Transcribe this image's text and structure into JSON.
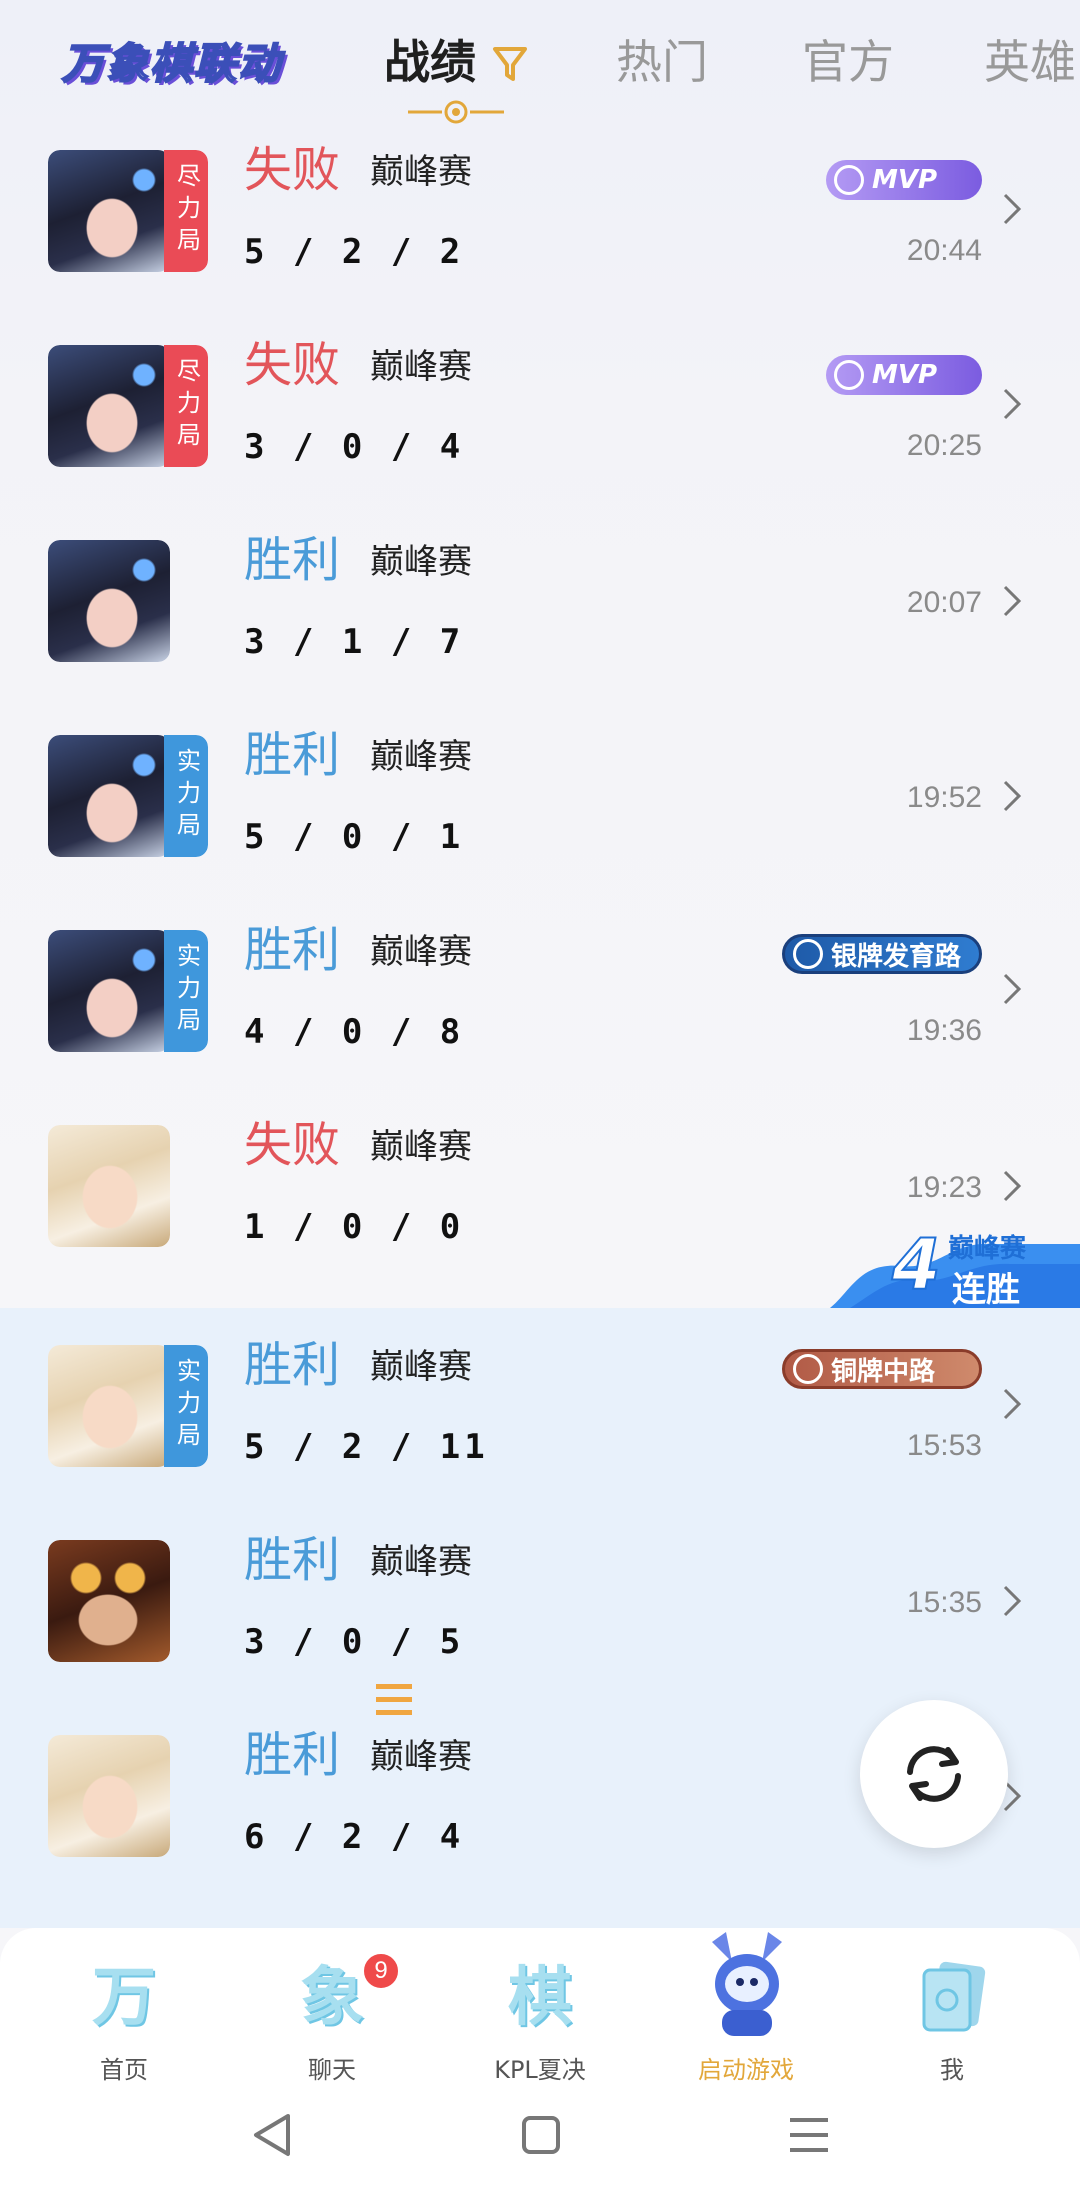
{
  "header": {
    "logo": "万象棋联动",
    "tabs": [
      {
        "label": "战绩",
        "active": true
      },
      {
        "label": "热门",
        "active": false
      },
      {
        "label": "官方",
        "active": false
      },
      {
        "label": "英雄",
        "active": false
      }
    ]
  },
  "matches": [
    {
      "result": "失败",
      "mode": "巅峰赛",
      "kda": "5 / 2 / 2",
      "time": "20:44",
      "tag": "尽力局",
      "badge": "MVP"
    },
    {
      "result": "失败",
      "mode": "巅峰赛",
      "kda": "3 / 0 / 4",
      "time": "20:25",
      "tag": "尽力局",
      "badge": "MVP"
    },
    {
      "result": "胜利",
      "mode": "巅峰赛",
      "kda": "3 / 1 / 7",
      "time": "20:07",
      "tag": "",
      "badge": ""
    },
    {
      "result": "胜利",
      "mode": "巅峰赛",
      "kda": "5 / 0 / 1",
      "time": "19:52",
      "tag": "实力局",
      "badge": ""
    },
    {
      "result": "胜利",
      "mode": "巅峰赛",
      "kda": "4 / 0 / 8",
      "time": "19:36",
      "tag": "实力局",
      "badge": "银牌发育路"
    },
    {
      "result": "失败",
      "mode": "巅峰赛",
      "kda": "1 / 0 / 0",
      "time": "19:23",
      "tag": "",
      "badge": ""
    },
    {
      "result": "胜利",
      "mode": "巅峰赛",
      "kda": "5 / 2 / 11",
      "time": "15:53",
      "tag": "实力局",
      "badge": "铜牌中路"
    },
    {
      "result": "胜利",
      "mode": "巅峰赛",
      "kda": "3 / 0 / 5",
      "time": "15:35",
      "tag": "",
      "badge": ""
    },
    {
      "result": "胜利",
      "mode": "巅峰赛",
      "kda": "6 / 2 / 4",
      "time": "",
      "tag": "",
      "badge": ""
    }
  ],
  "streak": {
    "count": "4",
    "mode": "巅峰赛",
    "label": "连胜"
  },
  "bottom_nav": [
    {
      "glyph": "万",
      "label": "首页"
    },
    {
      "glyph": "象",
      "label": "聊天",
      "badge": "9"
    },
    {
      "glyph": "棋",
      "label": "KPL夏决"
    },
    {
      "glyph": "",
      "label": "启动游戏",
      "active": true
    },
    {
      "glyph": "",
      "label": "我"
    }
  ],
  "colors": {
    "lose": "#e2555a",
    "win": "#4a9bd8",
    "accent": "#e2a73a",
    "streak_bg": "#e8f1fb"
  },
  "icons": {
    "filter": "filter-icon",
    "chevron": "chevron-right-icon",
    "refresh": "refresh-icon",
    "rank": "rank-lines-icon",
    "back": "back-triangle-icon",
    "home": "home-square-icon",
    "menu": "menu-lines-icon"
  }
}
